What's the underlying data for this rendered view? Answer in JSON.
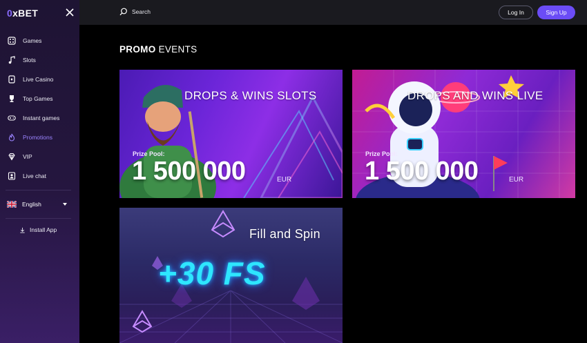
{
  "app": {
    "logo_zero": "0",
    "logo_rest": "xBET"
  },
  "colors": {
    "accent": "#6b4cf6",
    "active_nav": "#9b84ff",
    "sidebar_bg": "#25163f",
    "topbar_bg": "#1a1a1f"
  },
  "sidebar": {
    "items": [
      {
        "label": "Games",
        "icon": "dice-icon",
        "active": false
      },
      {
        "label": "Slots",
        "icon": "music-note-icon",
        "active": false
      },
      {
        "label": "Live Casino",
        "icon": "cards-icon",
        "active": false
      },
      {
        "label": "Top Games",
        "icon": "trophy-icon",
        "active": false
      },
      {
        "label": "Instant games",
        "icon": "gamepad-icon",
        "active": false
      },
      {
        "label": "Promotions",
        "icon": "flame-icon",
        "active": true
      },
      {
        "label": "VIP",
        "icon": "diamond-icon",
        "active": false
      },
      {
        "label": "Live chat",
        "icon": "chat-person-icon",
        "active": false
      }
    ],
    "language": "English",
    "install_label": "Install App"
  },
  "topbar": {
    "search_label": "Search",
    "login_label": "Log In",
    "signup_label": "Sign Up"
  },
  "main": {
    "title_bold": "PROMO",
    "title_rest": "EVENTS",
    "promos": [
      {
        "title": "DROPS & WINS SLOTS",
        "prize_label": "Prize Pool:",
        "prize_amount": "1 500 000",
        "currency": "EUR"
      },
      {
        "title": "DROPS AND WINS LIVE",
        "prize_label": "Prize Pool:",
        "prize_amount": "1 500 000",
        "currency": "EUR"
      },
      {
        "title": "Fill and Spin",
        "highlight": "+30 FS"
      }
    ]
  }
}
